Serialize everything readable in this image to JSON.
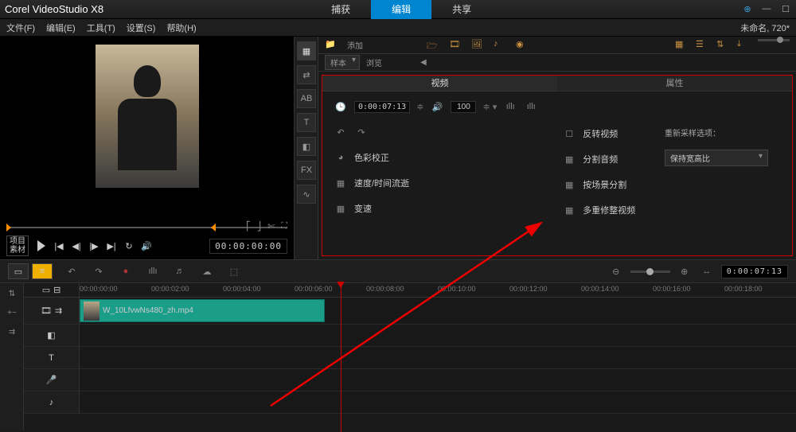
{
  "app": {
    "title": "Corel  VideoStudio X8"
  },
  "main_tabs": {
    "items": [
      "捕获",
      "编辑",
      "共享"
    ],
    "active_index": 1
  },
  "menu": {
    "items": [
      "文件(F)",
      "编辑(E)",
      "工具(T)",
      "设置(S)",
      "帮助(H)"
    ],
    "status_right": "未命名, 720*"
  },
  "preview": {
    "mode_labels": {
      "project": "项目",
      "clip": "素材"
    },
    "timecode": "00:00:00:00"
  },
  "library": {
    "side_tabs": [
      "媒",
      "AB",
      "T",
      "叠",
      "FX",
      "路"
    ],
    "add_folder": "添加",
    "browse": "浏览",
    "dropdown": "样本"
  },
  "options": {
    "tabs": {
      "video": "视频",
      "attribute": "属性"
    },
    "timecode": "0:00:07:13",
    "volume": "100",
    "col1": {
      "color_correct": "色彩校正",
      "speed": "速度/时间流逝",
      "morph": "变速"
    },
    "col2": {
      "reverse": "反转视频",
      "split_audio": "分割音频",
      "split_scene": "按场景分割",
      "multi_trim": "多重修整视频"
    },
    "col3": {
      "resample_label": "重新采样选项：",
      "resample_value": "保持宽高比"
    }
  },
  "timeline": {
    "ruler": [
      "00:00:00:00",
      "00:00:02:00",
      "00:00:04:00",
      "00:00:06:00",
      "00:00:08:00",
      "00:00:10:00",
      "00:00:12:00",
      "00:00:14:00",
      "00:00:16:00",
      "00:00:18:00"
    ],
    "current_tc": "0:00:07:13",
    "clip_name": "W_10LfvwNs480_zh.mp4"
  }
}
